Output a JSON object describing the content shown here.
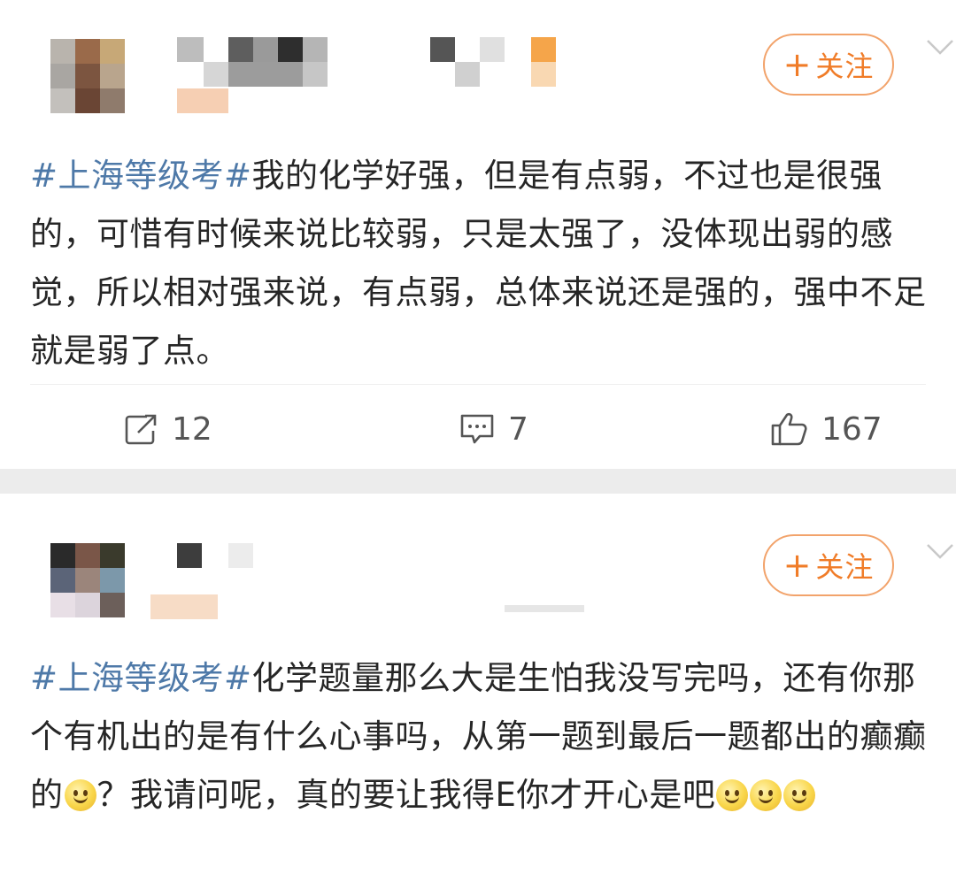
{
  "posts": [
    {
      "follow_label": "关注",
      "topic": "#上海等级考#",
      "body": "我的化学好强，但是有点弱，不过也是很强的，可惜有时候来说比较弱，只是太强了，没体现出弱的感觉，所以相对强来说，有点弱，总体来说还是强的，强中不足就是弱了点。",
      "repost_count": "12",
      "comment_count": "7",
      "like_count": "167"
    },
    {
      "follow_label": "关注",
      "topic": "#上海等级考#",
      "body_part1": "化学题量那么大是生怕我没写完吗，还有你那个有机出的是有什么心事吗，从第一题到最后一题都出的癫癫的",
      "body_part2": "？我请问呢，真的要让我得E你才开心是吧"
    }
  ],
  "icons": {
    "repost": "repost-icon",
    "comment": "comment-icon",
    "like": "thumbs-up-icon",
    "menu": "chevron-down-icon",
    "emoji": "smile-emoji-icon"
  },
  "colors": {
    "topic_link": "#4e79a8",
    "follow_accent": "#f07c28",
    "separator": "#ececec"
  }
}
